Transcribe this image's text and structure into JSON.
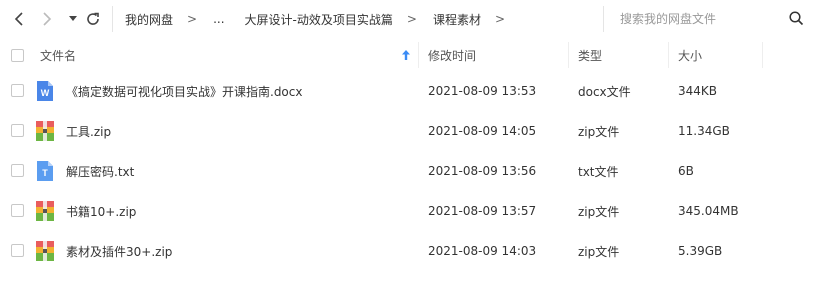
{
  "toolbar": {
    "breadcrumbs": [
      "我的网盘",
      "...",
      "大屏设计-动效及项目实战篇",
      "课程素材"
    ],
    "separator": ">",
    "search_placeholder": "搜索我的网盘文件"
  },
  "header": {
    "name": "文件名",
    "modified": "修改时间",
    "type": "类型",
    "size": "大小"
  },
  "files": [
    {
      "name": "《搞定数据可视化项目实战》开课指南.docx",
      "modified": "2021-08-09 13:53",
      "type": "docx文件",
      "size": "344KB",
      "icon": "word-doc-icon"
    },
    {
      "name": "工具.zip",
      "modified": "2021-08-09 14:05",
      "type": "zip文件",
      "size": "11.34GB",
      "icon": "zip-archive-icon"
    },
    {
      "name": "解压密码.txt",
      "modified": "2021-08-09 13:56",
      "type": "txt文件",
      "size": "6B",
      "icon": "text-file-icon"
    },
    {
      "name": "书籍10+.zip",
      "modified": "2021-08-09 13:57",
      "type": "zip文件",
      "size": "345.04MB",
      "icon": "zip-archive-icon"
    },
    {
      "name": "素材及插件30+.zip",
      "modified": "2021-08-09 14:03",
      "type": "zip文件",
      "size": "5.39GB",
      "icon": "zip-archive-icon"
    }
  ],
  "colors": {
    "word_blue": "#4a86e8",
    "txt_blue": "#5b9df0",
    "sort_arrow": "#3b8cf5"
  }
}
